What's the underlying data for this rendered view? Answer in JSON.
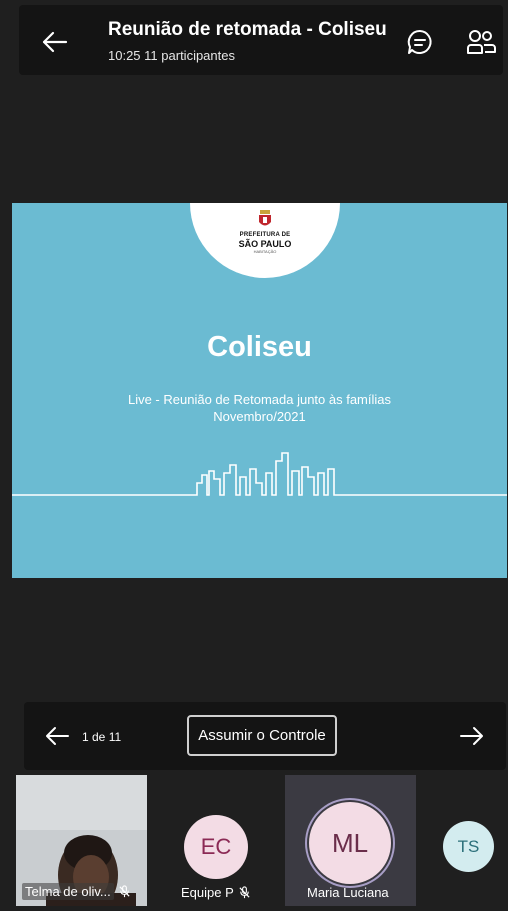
{
  "header": {
    "title": "Reunião de retomada - Coliseu",
    "time": "10:25",
    "participants": "11 participantes"
  },
  "slide": {
    "logo_line1": "PREFEITURA DE",
    "logo_line2": "SÃO PAULO",
    "logo_line3": "HABITAÇÃO",
    "title": "Coliseu",
    "subtitle1": "Live  -  Reunião de Retomada junto às famílias",
    "subtitle2": "Novembro/2021",
    "background_color": "#6bbbd2"
  },
  "controls": {
    "page_indicator": "1 de 11",
    "take_control_label": "Assumir o Controle"
  },
  "participants": [
    {
      "name": "Telma de oliv...",
      "initials": "",
      "muted": true
    },
    {
      "name": "Equipe P",
      "initials": "EC",
      "muted": true
    },
    {
      "name": "Maria Luciana",
      "initials": "ML",
      "muted": false,
      "speaking": true
    },
    {
      "name": "",
      "initials": "TS",
      "muted": false
    }
  ],
  "icons": {
    "back": "arrow-left-icon",
    "chat": "chat-icon",
    "people": "people-icon",
    "prev": "arrow-left-icon",
    "next": "arrow-right-icon",
    "mic_off": "mic-off-icon"
  }
}
